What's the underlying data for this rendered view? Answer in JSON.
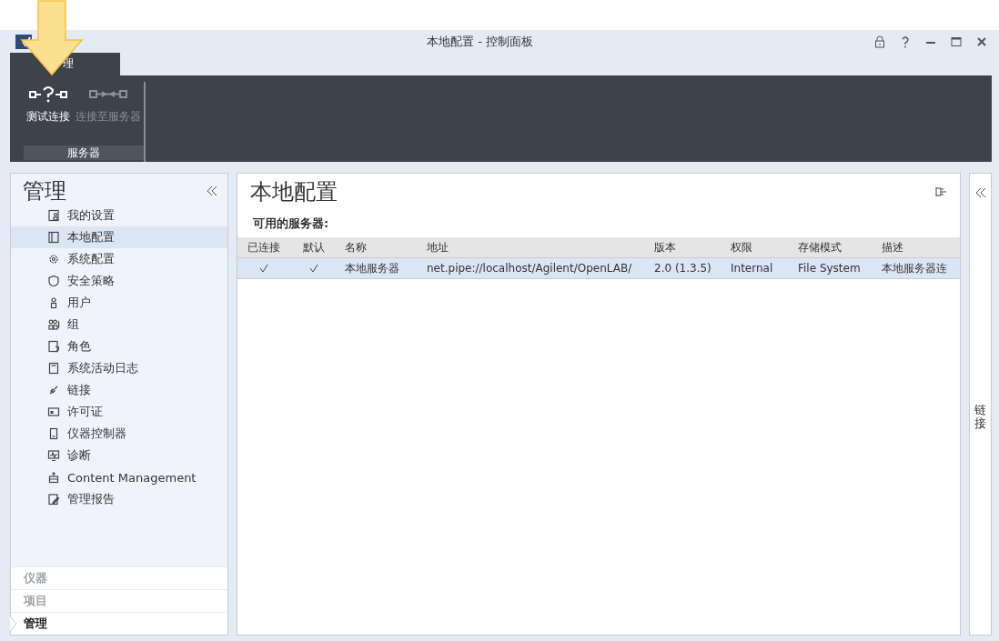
{
  "window": {
    "title": "本地配置 - 控制面板"
  },
  "ribbon": {
    "tabs": [
      {
        "label": "理",
        "selected": true
      }
    ],
    "groups": [
      {
        "label": "服务器",
        "buttons": [
          {
            "label": "测试连接",
            "kind": "test",
            "disabled": false
          },
          {
            "label": "连接至服务器",
            "kind": "connect",
            "disabled": true
          }
        ]
      }
    ]
  },
  "sidebar": {
    "title": "管理",
    "items": [
      {
        "label": "我的设置",
        "kind": "settings",
        "selected": false
      },
      {
        "label": "本地配置",
        "kind": "local",
        "selected": true
      },
      {
        "label": "系统配置",
        "kind": "gear",
        "selected": false
      },
      {
        "label": "安全策略",
        "kind": "shield",
        "selected": false
      },
      {
        "label": "用户",
        "kind": "user",
        "selected": false
      },
      {
        "label": "组",
        "kind": "group",
        "selected": false
      },
      {
        "label": "角色",
        "kind": "role",
        "selected": false
      },
      {
        "label": "系统活动日志",
        "kind": "log",
        "selected": false
      },
      {
        "label": "链接",
        "kind": "link",
        "selected": false
      },
      {
        "label": "许可证",
        "kind": "license",
        "selected": false
      },
      {
        "label": "仪器控制器",
        "kind": "device",
        "selected": false
      },
      {
        "label": "诊断",
        "kind": "monitor",
        "selected": false
      },
      {
        "label": "Content Management",
        "kind": "content",
        "selected": false
      },
      {
        "label": "管理报告",
        "kind": "report",
        "selected": false
      }
    ],
    "nav": [
      {
        "label": "仪器",
        "selected": false
      },
      {
        "label": "项目",
        "selected": false
      },
      {
        "label": "管理",
        "selected": true
      }
    ]
  },
  "main": {
    "title": "本地配置",
    "section": "可用的服务器:",
    "table": {
      "columns": [
        "已连接",
        "默认",
        "名称",
        "地址",
        "版本",
        "权限",
        "存储模式",
        "描述"
      ],
      "rows": [
        {
          "connected": true,
          "default": true,
          "name": "本地服务器",
          "address": "net.pipe://localhost/Agilent/OpenLAB/",
          "version": "2.0 (1.3.5)",
          "permission": "Internal",
          "storage": "File System",
          "description": "本地服务器连",
          "selected": true
        }
      ]
    }
  },
  "right_panel": {
    "label": "链接"
  }
}
